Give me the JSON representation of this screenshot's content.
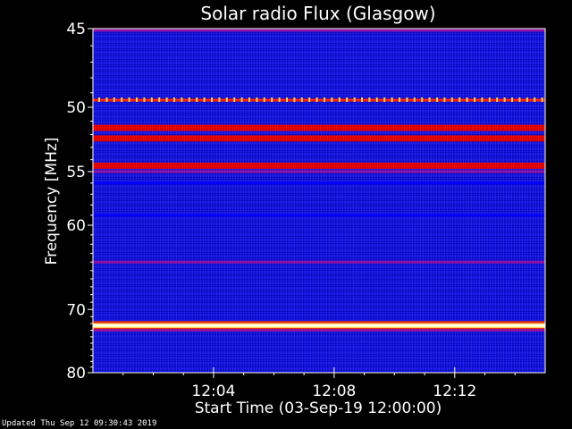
{
  "chart_data": {
    "type": "heatmap",
    "title": "Solar radio Flux (Glasgow)",
    "xlabel": "Start Time (03-Sep-19 12:00:00)",
    "ylabel": "Frequency [MHz]",
    "x_ticks": [
      "12:04",
      "12:08",
      "12:12"
    ],
    "x_tick_minutes": [
      4,
      8,
      12
    ],
    "xlim_minutes": [
      0,
      15
    ],
    "y_ticks": [
      45,
      50,
      55,
      60,
      70,
      80
    ],
    "ylim_mhz": [
      45,
      80
    ],
    "y_scale": "reciprocal",
    "colormap": [
      "#000000",
      "#00008b",
      "#0000ff",
      "#ff0000",
      "#ffff00",
      "#ffffff"
    ],
    "bands": [
      {
        "freq_mhz": 45.1,
        "level": 0.55
      },
      {
        "freq_mhz": 49.5,
        "level": 0.9,
        "note": "periodic spikes"
      },
      {
        "freq_mhz": 51.5,
        "level": 0.75
      },
      {
        "freq_mhz": 52.3,
        "level": 0.7
      },
      {
        "freq_mhz": 54.5,
        "level": 0.72
      },
      {
        "freq_mhz": 55.0,
        "level": 0.6
      },
      {
        "freq_mhz": 56.0,
        "level": 0.4
      },
      {
        "freq_mhz": 59.0,
        "level": 0.45
      },
      {
        "freq_mhz": 64.0,
        "level": 0.5
      },
      {
        "freq_mhz": 72.3,
        "level": 1.0
      },
      {
        "freq_mhz": 73.0,
        "level": 0.55
      }
    ]
  },
  "footer": {
    "updated": "Updated Thu Sep 12 09:30:43 2019"
  }
}
